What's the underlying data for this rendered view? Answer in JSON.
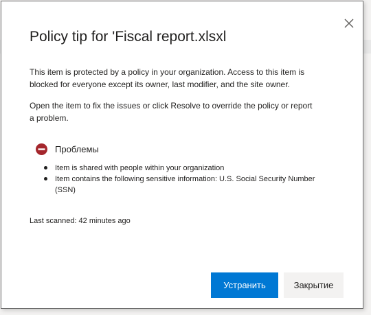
{
  "dialog": {
    "title": "Policy tip for 'Fiscal report.xlsxl",
    "close_icon": "close-icon",
    "paragraph_1": "This item is protected by a policy in your organization. Access to this item is blocked for everyone except its owner, last modifier, and the site owner.",
    "paragraph_2": "Open the item to fix the issues or click Resolve to override the policy or report a problem.",
    "issues": {
      "icon": "blocked-icon",
      "icon_color": "#a4262c",
      "label": "Проблемы",
      "items": [
        "Item is shared with people within your organization",
        "Item contains the following sensitive information: U.S. Social Security Number (SSN)"
      ]
    },
    "last_scanned": "Last scanned: 42 minutes ago",
    "buttons": {
      "resolve_label": "Устранить",
      "close_label": "Закрытие"
    }
  },
  "colors": {
    "primary": "#0078d4",
    "secondary_bg": "#f3f2f1",
    "text": "#201f1e"
  }
}
